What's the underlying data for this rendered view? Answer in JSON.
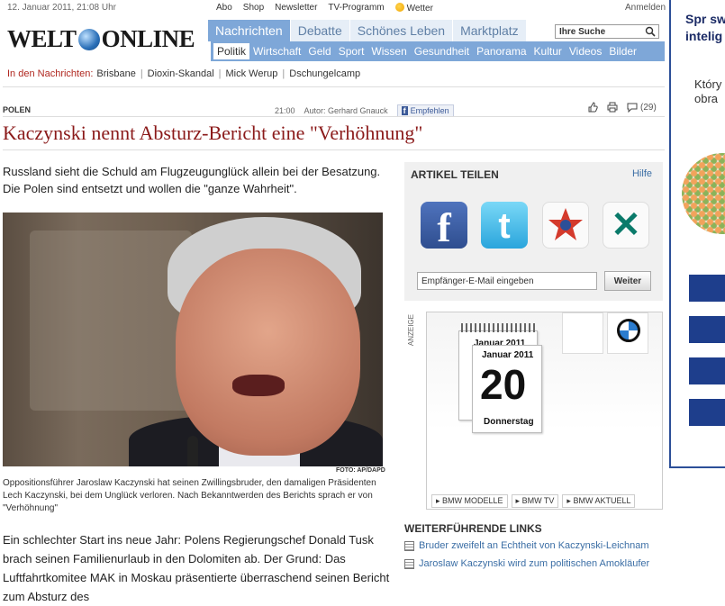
{
  "header": {
    "date": "12. Januar 2011, 21:08 Uhr",
    "top_links": [
      "Abo",
      "Shop",
      "Newsletter",
      "TV-Programm"
    ],
    "weather": "Wetter",
    "login": "Anmelden",
    "logo_left": "WELT",
    "logo_right": "ONLINE"
  },
  "nav": {
    "tabs": [
      {
        "label": "Nachrichten",
        "active": true
      },
      {
        "label": "Debatte",
        "active": false
      },
      {
        "label": "Schönes Leben",
        "active": false
      },
      {
        "label": "Marktplatz",
        "active": false
      }
    ],
    "search_value": "Ihre Suche",
    "sub_items": [
      {
        "label": "Politik",
        "active": true
      },
      {
        "label": "Wirtschaft"
      },
      {
        "label": "Geld"
      },
      {
        "label": "Sport"
      },
      {
        "label": "Wissen"
      },
      {
        "label": "Gesundheit"
      },
      {
        "label": "Panorama"
      },
      {
        "label": "Kultur"
      },
      {
        "label": "Videos"
      },
      {
        "label": "Bilder"
      }
    ],
    "accent": "#7ea7d8"
  },
  "in_news": {
    "label": "In den Nachrichten:",
    "items": [
      "Brisbane",
      "Dioxin-Skandal",
      "Mick Werup",
      "Dschungelcamp"
    ]
  },
  "article": {
    "section": "POLEN",
    "time": "21:00",
    "author": "Autor: Gerhard Gnauck",
    "recommend": "Empfehlen",
    "comments": "(29)",
    "headline": "Kaczynski nennt Absturz-Bericht eine \"Verhöhnung\"",
    "lead": "Russland sieht die Schuld am Flugzeugunglück allein bei der Besatzung. Die Polen sind entsetzt und wollen die \"ganze Wahrheit\".",
    "photo_credit": "FOTO: AP/DAPD",
    "caption": "Oppositionsführer Jaroslaw Kaczynski hat seinen Zwillingsbruder, den damaligen Präsidenten Lech Kaczynski, bei dem Unglück verloren. Nach Bekanntwerden des Berichts sprach er von \"Verhöhnung\"",
    "body": "Ein schlechter Start ins neue Jahr: Polens Regierungschef Donald Tusk brach seinen Familienurlaub in den Dolomiten ab. Der Grund: Das Luftfahrtkomitee MAK in Moskau präsentierte überraschend seinen Bericht zum Absturz des"
  },
  "share": {
    "title": "ARTIKEL TEILEN",
    "help": "Hilfe",
    "email_placeholder": "Empfänger-E-Mail eingeben",
    "button": "Weiter"
  },
  "ad": {
    "label": "ANZEIGE",
    "back_month": "Januar 2011",
    "month": "Januar 2011",
    "day": "20",
    "weekday": "Donnerstag",
    "links": [
      "BMW MODELLE",
      "BMW TV",
      "BMW AKTUELL"
    ]
  },
  "further": {
    "title": "WEITERFÜHRENDE LINKS",
    "links": [
      "Bruder zweifelt an Echtheit von Kaczynski-Leichnam",
      "Jaroslaw Kaczynski wird zum politischen Amokläufer"
    ]
  },
  "right_panel": {
    "title": "Spr sw intelig",
    "text": "Który wid obra"
  }
}
